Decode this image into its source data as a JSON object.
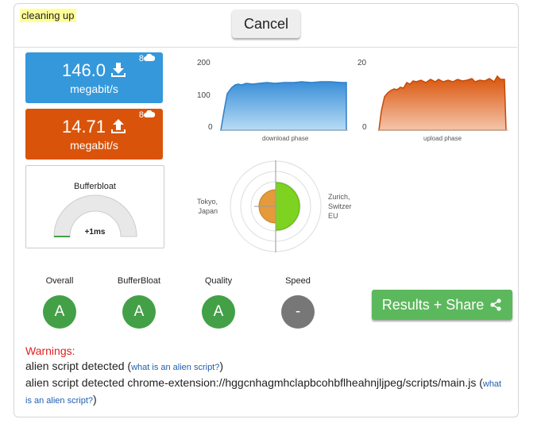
{
  "status": "cleaning up",
  "cancel_label": "Cancel",
  "download": {
    "value": "146.0",
    "unit": "megabit/s",
    "streams": "8"
  },
  "upload": {
    "value": "14.71",
    "unit": "megabit/s",
    "streams": "8"
  },
  "bufferbloat": {
    "title": "Bufferbloat",
    "value": "+1ms"
  },
  "charts": {
    "download": {
      "phase_label": "download phase",
      "ticks": [
        "200",
        "100",
        "0"
      ]
    },
    "upload": {
      "phase_label": "upload phase",
      "ticks": [
        "20",
        "0"
      ]
    }
  },
  "radar": {
    "left_location": [
      "Tokyo,",
      "Japan"
    ],
    "right_location": [
      "Zurich,",
      "Switzer",
      "EU"
    ]
  },
  "grades": [
    {
      "label": "Overall",
      "grade": "A"
    },
    {
      "label": "BufferBloat",
      "grade": "A"
    },
    {
      "label": "Quality",
      "grade": "A"
    },
    {
      "label": "Speed",
      "grade": "-"
    }
  ],
  "results_share_label": "Results + Share",
  "warnings": {
    "title": "Warnings:",
    "line1_text": "alien script detected (",
    "line1_link": "what is an alien script?",
    "line1_end": ")",
    "line2_text": "alien script detected chrome-extension://hggcnhagmhclapbcohbflheahnjljpeg/scripts/main.js (",
    "line2_link": "what is an alien script?",
    "line2_end": ")"
  },
  "colors": {
    "download": "#3498db",
    "upload": "#d9540a",
    "grade_good": "#43a047",
    "grade_na": "#777777",
    "share": "#5cb85c"
  }
}
